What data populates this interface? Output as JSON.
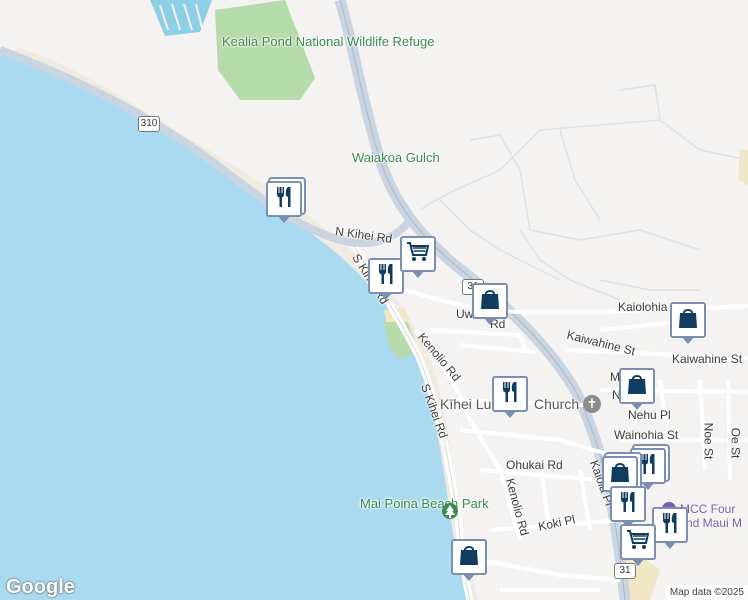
{
  "colors": {
    "water": "#aadaf0",
    "land": "#f4f3f1",
    "park": "#b5dcaa",
    "road_major": "#c9d5e0",
    "pin_border": "#7b8fb2",
    "pin_icon": "#0f3c5f"
  },
  "labels": {
    "refuge": "Kealia Pond National Wildlife Refuge",
    "gulch": "Waiakoa Gulch",
    "n_kihei_rd": "N Kihei Rd",
    "s_kihei_rd_upper": "S Kihei Rd",
    "s_kihei_rd_lower": "S Kihei Rd",
    "kenolio_rd_upper": "Kenolio Rd",
    "kenolio_rd_lower": "Kenolio Rd",
    "uwapo_rd": "Uwa",
    "uwapo_rd_tail": "Rd",
    "kaiolohia_st": "Kaiolohia S",
    "kaiwahine_st_left": "Kaiwahine St",
    "kaiwahine_st_right": "Kaiwahine St",
    "m_label": "M",
    "n_label": "N",
    "nehu_pl": "Nehu Pl",
    "wainohia_st": "Wainohia St",
    "noe_st": "Noe St",
    "oe_st": "Oe St",
    "ohukai_rd": "Ohukai Rd",
    "kaiola_pl": "Kaiola Pl",
    "koki_pl": "Koki Pl",
    "church": "Kīhei Lu",
    "church_tail": "Church",
    "beach_park": "Mai Poina Beach Park",
    "school_1": "MCC Four",
    "school_2": "nd Maui M"
  },
  "shields": {
    "hwy_310": "310",
    "hwy_31_a": "31",
    "hwy_31_b": "31"
  },
  "pins": [
    {
      "name": "restaurant-pin-1",
      "icon": "restaurant"
    },
    {
      "name": "restaurant-pin-2",
      "icon": "restaurant"
    },
    {
      "name": "grocery-pin-1",
      "icon": "grocery"
    },
    {
      "name": "shopping-pin-1",
      "icon": "shopping"
    },
    {
      "name": "shopping-pin-2",
      "icon": "shopping"
    },
    {
      "name": "restaurant-pin-3",
      "icon": "restaurant"
    },
    {
      "name": "shopping-pin-3",
      "icon": "shopping"
    },
    {
      "name": "restaurant-pin-4",
      "icon": "restaurant"
    },
    {
      "name": "shopping-pin-4",
      "icon": "shopping"
    },
    {
      "name": "restaurant-pin-5",
      "icon": "restaurant"
    },
    {
      "name": "restaurant-pin-6",
      "icon": "restaurant"
    },
    {
      "name": "grocery-pin-2",
      "icon": "grocery"
    },
    {
      "name": "shopping-pin-5",
      "icon": "shopping"
    }
  ],
  "branding": {
    "logo": "Google",
    "attribution": "Map data ©2025"
  }
}
